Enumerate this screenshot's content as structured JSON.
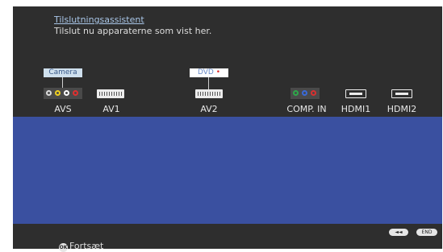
{
  "header": {
    "title": "Tilslutningsassistent",
    "subtitle": "Tilslut nu apparaterne som vist her."
  },
  "tags": {
    "camera": "Camera",
    "dvd": "DVD",
    "dvd_dot": "•"
  },
  "ports": [
    {
      "label": "AVS"
    },
    {
      "label": "AV1"
    },
    {
      "label": "AV2"
    },
    {
      "label": "COMP. IN"
    },
    {
      "label": "HDMI1"
    },
    {
      "label": "HDMI2"
    }
  ],
  "nav": {
    "back_button": "◄◄",
    "end_button": "END"
  },
  "footer": {
    "ok_icon": "OK",
    "continue_label": "Fortsæt"
  },
  "colors": {
    "background": "#2e2e2e",
    "panel": "#3a50a0",
    "title": "#a9c6e8",
    "dvd_dot": "#e02a2a"
  },
  "icons": [
    "s-video-icon",
    "composite-rca-icon",
    "scart-icon",
    "component-rca-icon",
    "hdmi-icon",
    "ok-button-icon"
  ]
}
